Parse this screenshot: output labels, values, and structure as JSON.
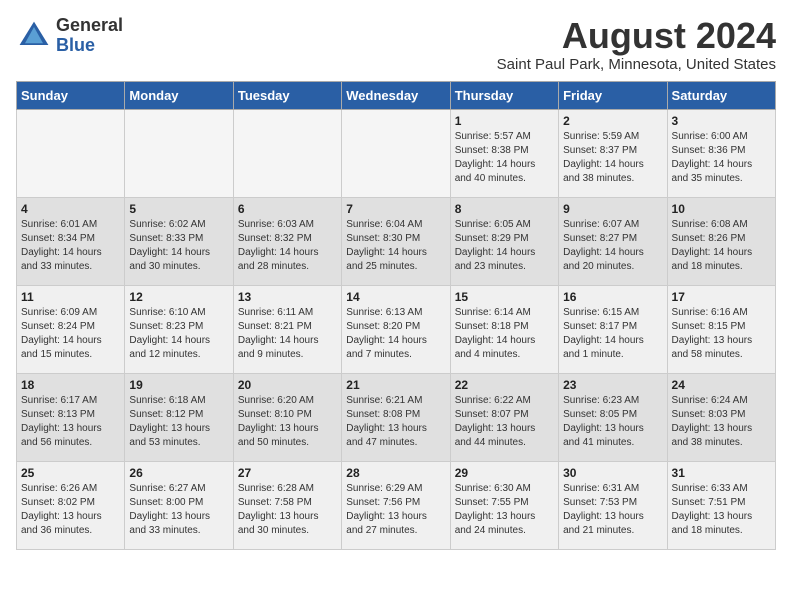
{
  "header": {
    "logo_line1": "General",
    "logo_line2": "Blue",
    "month": "August 2024",
    "location": "Saint Paul Park, Minnesota, United States"
  },
  "days_of_week": [
    "Sunday",
    "Monday",
    "Tuesday",
    "Wednesday",
    "Thursday",
    "Friday",
    "Saturday"
  ],
  "weeks": [
    [
      {
        "day": "",
        "info": ""
      },
      {
        "day": "",
        "info": ""
      },
      {
        "day": "",
        "info": ""
      },
      {
        "day": "",
        "info": ""
      },
      {
        "day": "1",
        "info": "Sunrise: 5:57 AM\nSunset: 8:38 PM\nDaylight: 14 hours and 40 minutes."
      },
      {
        "day": "2",
        "info": "Sunrise: 5:59 AM\nSunset: 8:37 PM\nDaylight: 14 hours and 38 minutes."
      },
      {
        "day": "3",
        "info": "Sunrise: 6:00 AM\nSunset: 8:36 PM\nDaylight: 14 hours and 35 minutes."
      }
    ],
    [
      {
        "day": "4",
        "info": "Sunrise: 6:01 AM\nSunset: 8:34 PM\nDaylight: 14 hours and 33 minutes."
      },
      {
        "day": "5",
        "info": "Sunrise: 6:02 AM\nSunset: 8:33 PM\nDaylight: 14 hours and 30 minutes."
      },
      {
        "day": "6",
        "info": "Sunrise: 6:03 AM\nSunset: 8:32 PM\nDaylight: 14 hours and 28 minutes."
      },
      {
        "day": "7",
        "info": "Sunrise: 6:04 AM\nSunset: 8:30 PM\nDaylight: 14 hours and 25 minutes."
      },
      {
        "day": "8",
        "info": "Sunrise: 6:05 AM\nSunset: 8:29 PM\nDaylight: 14 hours and 23 minutes."
      },
      {
        "day": "9",
        "info": "Sunrise: 6:07 AM\nSunset: 8:27 PM\nDaylight: 14 hours and 20 minutes."
      },
      {
        "day": "10",
        "info": "Sunrise: 6:08 AM\nSunset: 8:26 PM\nDaylight: 14 hours and 18 minutes."
      }
    ],
    [
      {
        "day": "11",
        "info": "Sunrise: 6:09 AM\nSunset: 8:24 PM\nDaylight: 14 hours and 15 minutes."
      },
      {
        "day": "12",
        "info": "Sunrise: 6:10 AM\nSunset: 8:23 PM\nDaylight: 14 hours and 12 minutes."
      },
      {
        "day": "13",
        "info": "Sunrise: 6:11 AM\nSunset: 8:21 PM\nDaylight: 14 hours and 9 minutes."
      },
      {
        "day": "14",
        "info": "Sunrise: 6:13 AM\nSunset: 8:20 PM\nDaylight: 14 hours and 7 minutes."
      },
      {
        "day": "15",
        "info": "Sunrise: 6:14 AM\nSunset: 8:18 PM\nDaylight: 14 hours and 4 minutes."
      },
      {
        "day": "16",
        "info": "Sunrise: 6:15 AM\nSunset: 8:17 PM\nDaylight: 14 hours and 1 minute."
      },
      {
        "day": "17",
        "info": "Sunrise: 6:16 AM\nSunset: 8:15 PM\nDaylight: 13 hours and 58 minutes."
      }
    ],
    [
      {
        "day": "18",
        "info": "Sunrise: 6:17 AM\nSunset: 8:13 PM\nDaylight: 13 hours and 56 minutes."
      },
      {
        "day": "19",
        "info": "Sunrise: 6:18 AM\nSunset: 8:12 PM\nDaylight: 13 hours and 53 minutes."
      },
      {
        "day": "20",
        "info": "Sunrise: 6:20 AM\nSunset: 8:10 PM\nDaylight: 13 hours and 50 minutes."
      },
      {
        "day": "21",
        "info": "Sunrise: 6:21 AM\nSunset: 8:08 PM\nDaylight: 13 hours and 47 minutes."
      },
      {
        "day": "22",
        "info": "Sunrise: 6:22 AM\nSunset: 8:07 PM\nDaylight: 13 hours and 44 minutes."
      },
      {
        "day": "23",
        "info": "Sunrise: 6:23 AM\nSunset: 8:05 PM\nDaylight: 13 hours and 41 minutes."
      },
      {
        "day": "24",
        "info": "Sunrise: 6:24 AM\nSunset: 8:03 PM\nDaylight: 13 hours and 38 minutes."
      }
    ],
    [
      {
        "day": "25",
        "info": "Sunrise: 6:26 AM\nSunset: 8:02 PM\nDaylight: 13 hours and 36 minutes."
      },
      {
        "day": "26",
        "info": "Sunrise: 6:27 AM\nSunset: 8:00 PM\nDaylight: 13 hours and 33 minutes."
      },
      {
        "day": "27",
        "info": "Sunrise: 6:28 AM\nSunset: 7:58 PM\nDaylight: 13 hours and 30 minutes."
      },
      {
        "day": "28",
        "info": "Sunrise: 6:29 AM\nSunset: 7:56 PM\nDaylight: 13 hours and 27 minutes."
      },
      {
        "day": "29",
        "info": "Sunrise: 6:30 AM\nSunset: 7:55 PM\nDaylight: 13 hours and 24 minutes."
      },
      {
        "day": "30",
        "info": "Sunrise: 6:31 AM\nSunset: 7:53 PM\nDaylight: 13 hours and 21 minutes."
      },
      {
        "day": "31",
        "info": "Sunrise: 6:33 AM\nSunset: 7:51 PM\nDaylight: 13 hours and 18 minutes."
      }
    ]
  ]
}
